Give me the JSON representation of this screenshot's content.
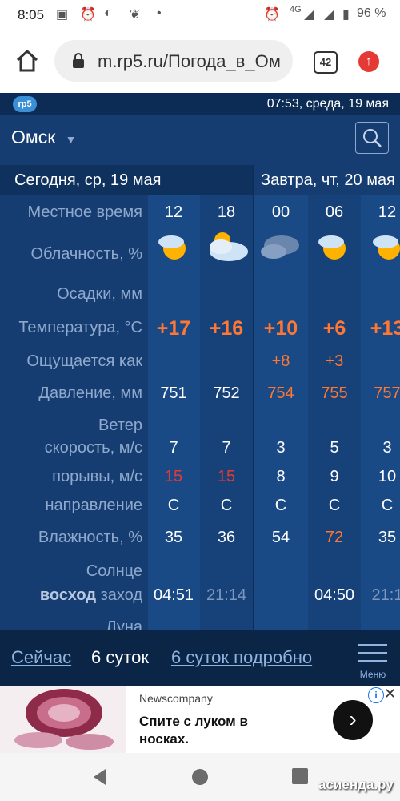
{
  "status": {
    "time": "8:05",
    "network": "4G",
    "battery": "96 %"
  },
  "browser": {
    "url": "m.rp5.ru/Погода_в_Ом",
    "tabs": "42"
  },
  "site": {
    "logo": "rp5",
    "datetime": "07:53, среда, 19 мая",
    "city": "Омск",
    "today_header": "Сегодня, ср, 19 мая",
    "tomorrow_header": "Завтра, чт, 20 мая",
    "labels": {
      "time": "Местное время",
      "cloud": "Облачность, %",
      "precip": "Осадки, мм",
      "temp": "Температура, °C",
      "feels": "Ощущается как",
      "pressure": "Давление, мм",
      "wind": "Ветер",
      "wind_speed": "скорость, м/с",
      "gusts": "порывы, м/с",
      "direction": "направление",
      "humidity": "Влажность, %",
      "sun": "Солнце",
      "sunrise": "восход",
      "sunset": "заход",
      "moon": "Луна"
    },
    "columns": [
      {
        "hour": "12",
        "temp": "+17",
        "feels": "",
        "pressure": "751",
        "wind": "7",
        "gust": "15",
        "dir": "С",
        "hum": "35",
        "sunrise": "04:51",
        "sunset": ""
      },
      {
        "hour": "18",
        "temp": "+16",
        "feels": "",
        "pressure": "752",
        "wind": "7",
        "gust": "15",
        "dir": "С",
        "hum": "36",
        "sunrise": "",
        "sunset": "21:14"
      },
      {
        "hour": "00",
        "temp": "+10",
        "feels": "+8",
        "pressure": "754",
        "wind": "3",
        "gust": "8",
        "dir": "С",
        "hum": "54",
        "sunrise": "",
        "sunset": ""
      },
      {
        "hour": "06",
        "temp": "+6",
        "feels": "+3",
        "pressure": "755",
        "wind": "5",
        "gust": "9",
        "dir": "С",
        "hum": "72",
        "sunrise": "04:50",
        "sunset": ""
      },
      {
        "hour": "12",
        "temp": "+13",
        "feels": "",
        "pressure": "757",
        "wind": "3",
        "gust": "10",
        "dir": "С",
        "hum": "35",
        "sunrise": "",
        "sunset": "21:1"
      }
    ]
  },
  "nav": {
    "now": "Сейчас",
    "six": "6 суток",
    "detailed": "6 суток подробно",
    "menu": "Меню"
  },
  "ad": {
    "source": "Newscompany",
    "title": "Спите с луком в носках."
  },
  "watermark": "асиенда.ру"
}
